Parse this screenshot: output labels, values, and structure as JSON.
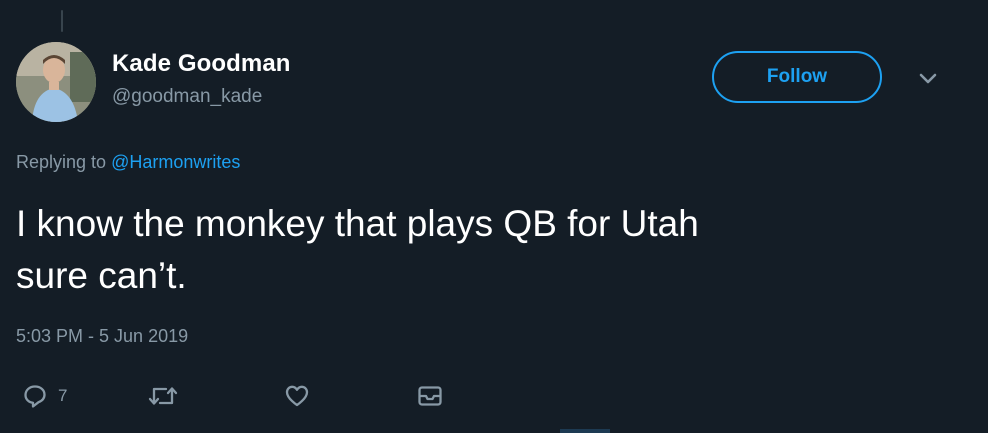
{
  "tweet": {
    "author_name": "Kade Goodman",
    "author_handle": "@goodman_kade",
    "follow_label": "Follow",
    "replying_prefix": "Replying to",
    "replying_mention": "@Harmonwrites",
    "text_line1": "I know the monkey that plays QB for Utah",
    "text_line2": "sure can’t.",
    "timestamp": "5:03 PM - 5 Jun 2019",
    "actions": {
      "reply_count": "7",
      "retweet_count": "",
      "like_count": ""
    }
  },
  "colors": {
    "background": "#141d26",
    "accent": "#1da1f2",
    "secondary_text": "#8899a6",
    "primary_text": "#ffffff"
  },
  "icons": [
    "reply-icon",
    "retweet-icon",
    "like-icon",
    "message-icon",
    "chevron-down-icon"
  ]
}
